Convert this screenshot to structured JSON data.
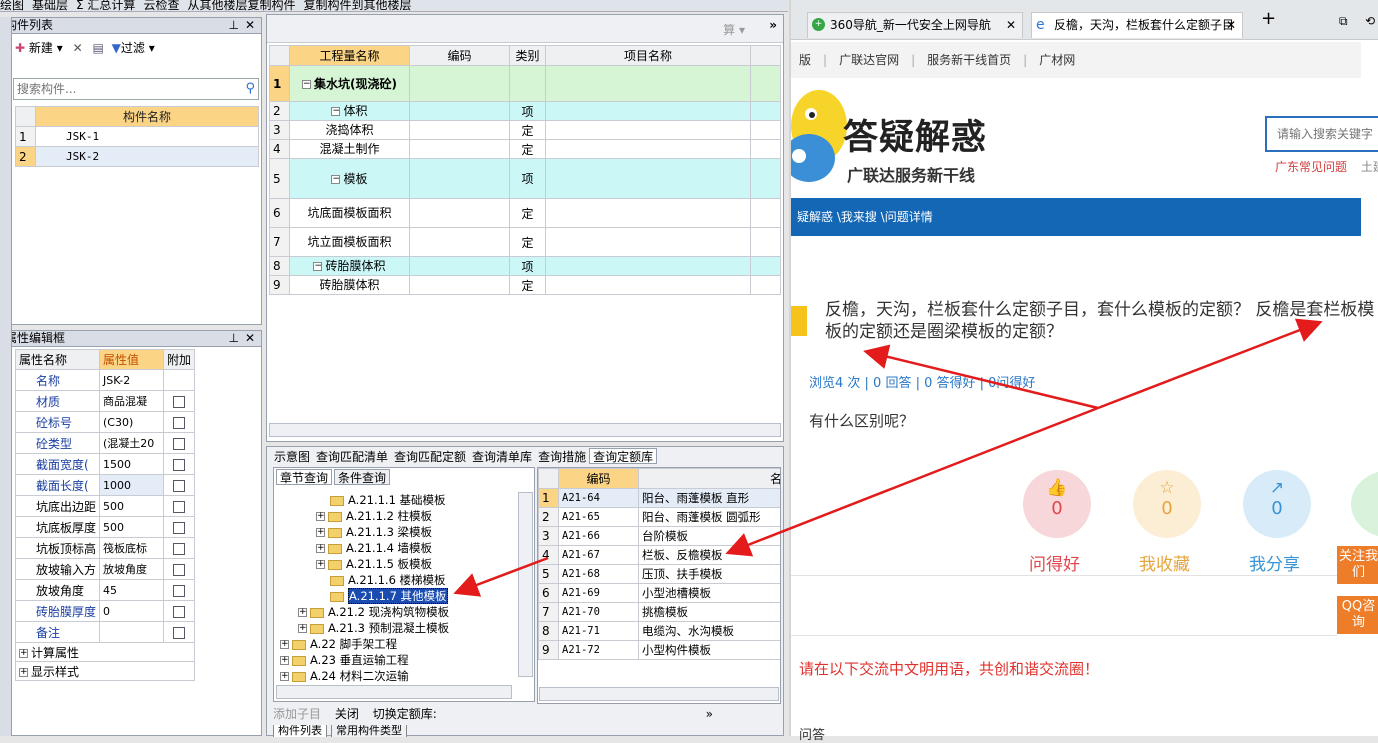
{
  "toolbar": {
    "items": [
      "绘图",
      "基础层",
      "Σ 汇总计算",
      "云检查",
      "从其他楼层复制构件",
      "复制构件到其他楼层"
    ]
  },
  "component_list": {
    "title": "构件列表",
    "new_label": "新建",
    "filter_label": "过滤",
    "search_placeholder": "搜索构件...",
    "column": "构件名称",
    "rows": [
      {
        "num": "1",
        "name": "JSK-1"
      },
      {
        "num": "2",
        "name": "JSK-2"
      }
    ]
  },
  "property_editor": {
    "title": "属性编辑框",
    "headers": [
      "属性名称",
      "属性值",
      "附加"
    ],
    "rows": [
      {
        "name": "名称",
        "value": "JSK-2",
        "blue": true,
        "cb": false
      },
      {
        "name": "材质",
        "value": "商品混凝",
        "blue": true,
        "cb": true
      },
      {
        "name": "砼标号",
        "value": "(C30)",
        "blue": true,
        "cb": true
      },
      {
        "name": "砼类型",
        "value": "(混凝土20",
        "blue": true,
        "cb": true
      },
      {
        "name": "截面宽度(",
        "value": "1500",
        "blue": true,
        "cb": true
      },
      {
        "name": "截面长度(",
        "value": "1000",
        "blue": true,
        "cb": true
      },
      {
        "name": "坑底出边距",
        "value": "500",
        "blue": false,
        "cb": true
      },
      {
        "name": "坑底板厚度",
        "value": "500",
        "blue": false,
        "cb": true
      },
      {
        "name": "坑板顶标高",
        "value": "筏板底标",
        "blue": false,
        "cb": true
      },
      {
        "name": "放坡输入方",
        "value": "放坡角度",
        "blue": false,
        "cb": true
      },
      {
        "name": "放坡角度",
        "value": "45",
        "blue": false,
        "cb": true
      },
      {
        "name": "砖胎膜厚度",
        "value": "0",
        "blue": true,
        "cb": true
      },
      {
        "name": "备注",
        "value": "",
        "blue": true,
        "cb": true
      }
    ],
    "groups": [
      "计算属性",
      "显示样式"
    ]
  },
  "quantity_table": {
    "compute_label": "算",
    "headers": [
      "工程量名称",
      "编码",
      "类别",
      "项目名称"
    ],
    "rows": [
      {
        "num": "1",
        "name": "集水坑(现浇砼)",
        "type": "",
        "cls": "green"
      },
      {
        "num": "2",
        "name": "体积",
        "type": "项",
        "cls": "cyan"
      },
      {
        "num": "3",
        "name": "浇捣体积",
        "type": "定",
        "cls": ""
      },
      {
        "num": "4",
        "name": "混凝土制作",
        "type": "定",
        "cls": ""
      },
      {
        "num": "5",
        "name": "模板",
        "type": "项",
        "cls": "cyan"
      },
      {
        "num": "6",
        "name": "坑底面模板面积",
        "type": "定",
        "cls": ""
      },
      {
        "num": "7",
        "name": "坑立面模板面积",
        "type": "定",
        "cls": ""
      },
      {
        "num": "8",
        "name": "砖胎膜体积",
        "type": "项",
        "cls": "cyan"
      },
      {
        "num": "9",
        "name": "砖胎膜体积",
        "type": "定",
        "cls": ""
      }
    ]
  },
  "query_tabs": [
    "示意图",
    "查询匹配清单",
    "查询匹配定额",
    "查询清单库",
    "查询措施",
    "查询定额库"
  ],
  "subtabs": [
    "章节查询",
    "条件查询"
  ],
  "tree": [
    {
      "label": "A.21.1.1 基础模板",
      "indent": 2,
      "exp": false
    },
    {
      "label": "A.21.1.2 柱模板",
      "indent": 2,
      "exp": true
    },
    {
      "label": "A.21.1.3 梁模板",
      "indent": 2,
      "exp": true
    },
    {
      "label": "A.21.1.4 墙模板",
      "indent": 2,
      "exp": true
    },
    {
      "label": "A.21.1.5 板模板",
      "indent": 2,
      "exp": true
    },
    {
      "label": "A.21.1.6 楼梯模板",
      "indent": 2,
      "exp": false
    },
    {
      "label": "A.21.1.7 其他模板",
      "indent": 2,
      "exp": false,
      "selected": true
    },
    {
      "label": "A.21.2 现浇构筑物模板",
      "indent": 1,
      "exp": true
    },
    {
      "label": "A.21.3 预制混凝土模板",
      "indent": 1,
      "exp": true
    },
    {
      "label": "A.22 脚手架工程",
      "indent": 0,
      "exp": true
    },
    {
      "label": "A.23 垂直运输工程",
      "indent": 0,
      "exp": true
    },
    {
      "label": "A.24 材料二次运输",
      "indent": 0,
      "exp": true
    }
  ],
  "quota_table": {
    "headers": [
      "编码",
      "名称"
    ],
    "rows": [
      {
        "num": "1",
        "code": "A21-64",
        "name": "阳台、雨蓬模板 直形"
      },
      {
        "num": "2",
        "code": "A21-65",
        "name": "阳台、雨蓬模板 圆弧形"
      },
      {
        "num": "3",
        "code": "A21-66",
        "name": "台阶模板"
      },
      {
        "num": "4",
        "code": "A21-67",
        "name": "栏板、反檐模板"
      },
      {
        "num": "5",
        "code": "A21-68",
        "name": "压顶、扶手模板"
      },
      {
        "num": "6",
        "code": "A21-69",
        "name": "小型池槽模板"
      },
      {
        "num": "7",
        "code": "A21-70",
        "name": "挑檐模板"
      },
      {
        "num": "8",
        "code": "A21-71",
        "name": "电缆沟、水沟模板"
      },
      {
        "num": "9",
        "code": "A21-72",
        "name": "小型构件模板"
      }
    ]
  },
  "bottom_bar": {
    "add": "添加子目",
    "close": "关闭",
    "switch": "切换定额库:",
    "more": "»"
  },
  "bottom_tabs": [
    "构件列表",
    "常用构件类型"
  ],
  "browser": {
    "tab1": "360导航_新一代安全上网导航",
    "tab2": "反檐，天沟，栏板套什么定额子目",
    "nav_links": [
      "版",
      "广联达官网",
      "服务新干线首页",
      "广材网"
    ],
    "logo_title": "答疑解惑",
    "logo_sub": "广联达服务新干线",
    "search_placeholder": "请输入搜索关键字",
    "region_links": [
      "广东常见问题",
      "土建"
    ],
    "breadcrumb": "疑解惑 \\我来搜 \\问题详情",
    "question": "反檐，天沟，栏板套什么定额子目，套什么模板的定额？ 反檐是套栏板模板的定额还是圈梁模板的定额？",
    "stats": "浏览4 次 | 0 回答 | 0 答得好 | 0问得好",
    "body": "有什么区别呢？",
    "actions": [
      {
        "label": "问得好",
        "count": "0",
        "color": "#f7d7d9",
        "text": "#e0484f",
        "icon": "👍"
      },
      {
        "label": "我收藏",
        "count": "0",
        "color": "#fbeed5",
        "text": "#e5a53e",
        "icon": "☆"
      },
      {
        "label": "我分享",
        "count": "0",
        "color": "#d7ecf8",
        "text": "#3a93d6",
        "icon": "↗"
      }
    ],
    "side_buttons": [
      "关注我们",
      "QQ咨询"
    ],
    "notice": "请在以下交流中文明用语，共创和谐交流圈！",
    "footer_partial": "问答"
  }
}
